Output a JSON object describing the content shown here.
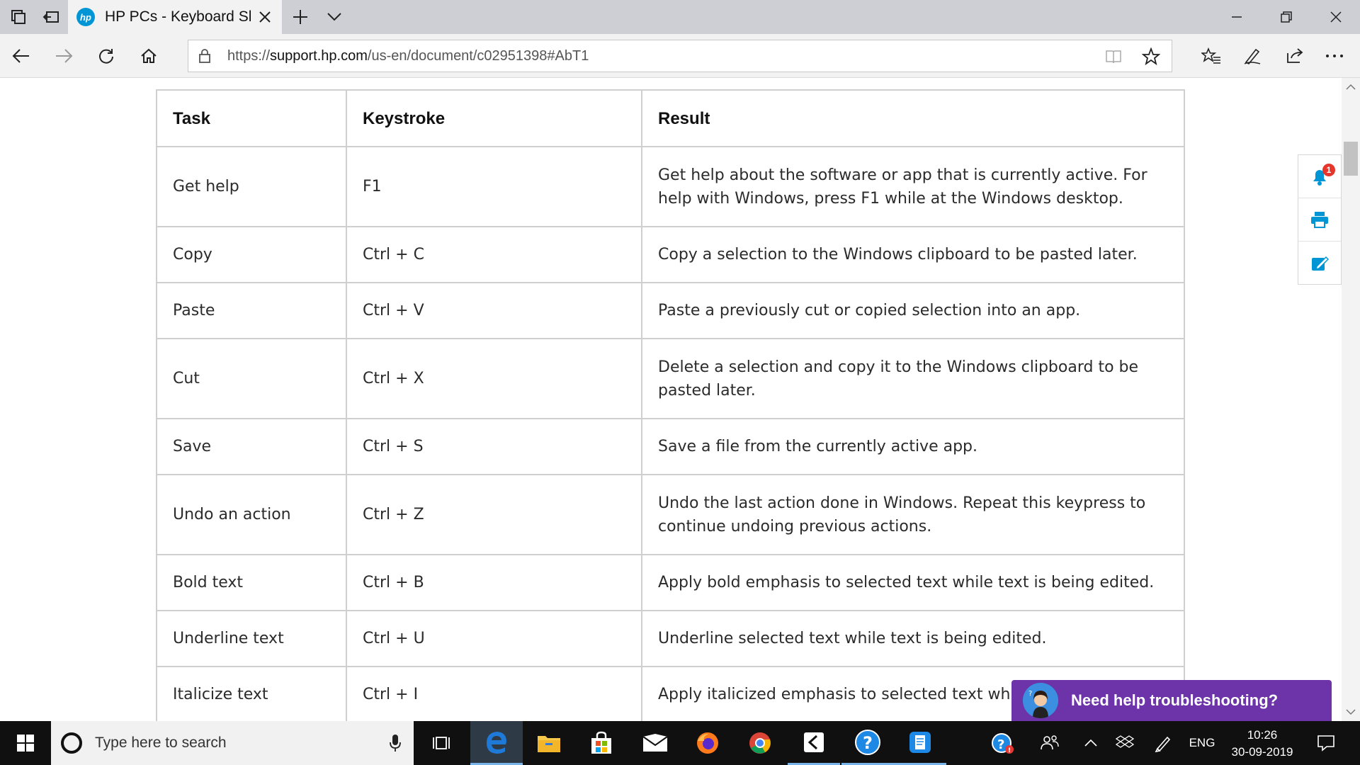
{
  "browser": {
    "tab": {
      "title": "HP PCs - Keyboard Shortcuts",
      "favicon": "hp-logo-icon"
    },
    "url": {
      "scheme": "https://",
      "host": "support.hp.com",
      "path": "/us-en/document/c02951398#AbT1"
    }
  },
  "table": {
    "headers": {
      "task": "Task",
      "keystroke": "Keystroke",
      "result": "Result"
    },
    "rows": [
      {
        "task": "Get help",
        "keystroke": "F1",
        "result": "Get help about the software or app that is currently active. For help with Windows, press F1 while at the Windows desktop."
      },
      {
        "task": "Copy",
        "keystroke": "Ctrl + C",
        "result": "Copy a selection to the Windows clipboard to be pasted later."
      },
      {
        "task": "Paste",
        "keystroke": "Ctrl + V",
        "result": "Paste a previously cut or copied selection into an app."
      },
      {
        "task": "Cut",
        "keystroke": "Ctrl + X",
        "result": "Delete a selection and copy it to the Windows clipboard to be pasted later."
      },
      {
        "task": "Save",
        "keystroke": "Ctrl + S",
        "result": "Save a file from the currently active app."
      },
      {
        "task": "Undo an action",
        "keystroke": "Ctrl + Z",
        "result": "Undo the last action done in Windows. Repeat this keypress to continue undoing previous actions."
      },
      {
        "task": "Bold text",
        "keystroke": "Ctrl + B",
        "result": "Apply bold emphasis to selected text while text is being edited."
      },
      {
        "task": "Underline text",
        "keystroke": "Ctrl + U",
        "result": "Underline selected text while text is being edited."
      },
      {
        "task": "Italicize text",
        "keystroke": "Ctrl + I",
        "result": "Apply italicized emphasis to selected text while"
      }
    ]
  },
  "side_tools": {
    "notification_count": "1"
  },
  "chat": {
    "label": "Need help troubleshooting?"
  },
  "taskbar": {
    "search_placeholder": "Type here to search",
    "language": "ENG",
    "time": "10:26",
    "date": "30-09-2019"
  },
  "colors": {
    "hp_blue": "#0096d6",
    "chat_purple": "#6c34a8",
    "edge_blue": "#1e7ad6"
  }
}
